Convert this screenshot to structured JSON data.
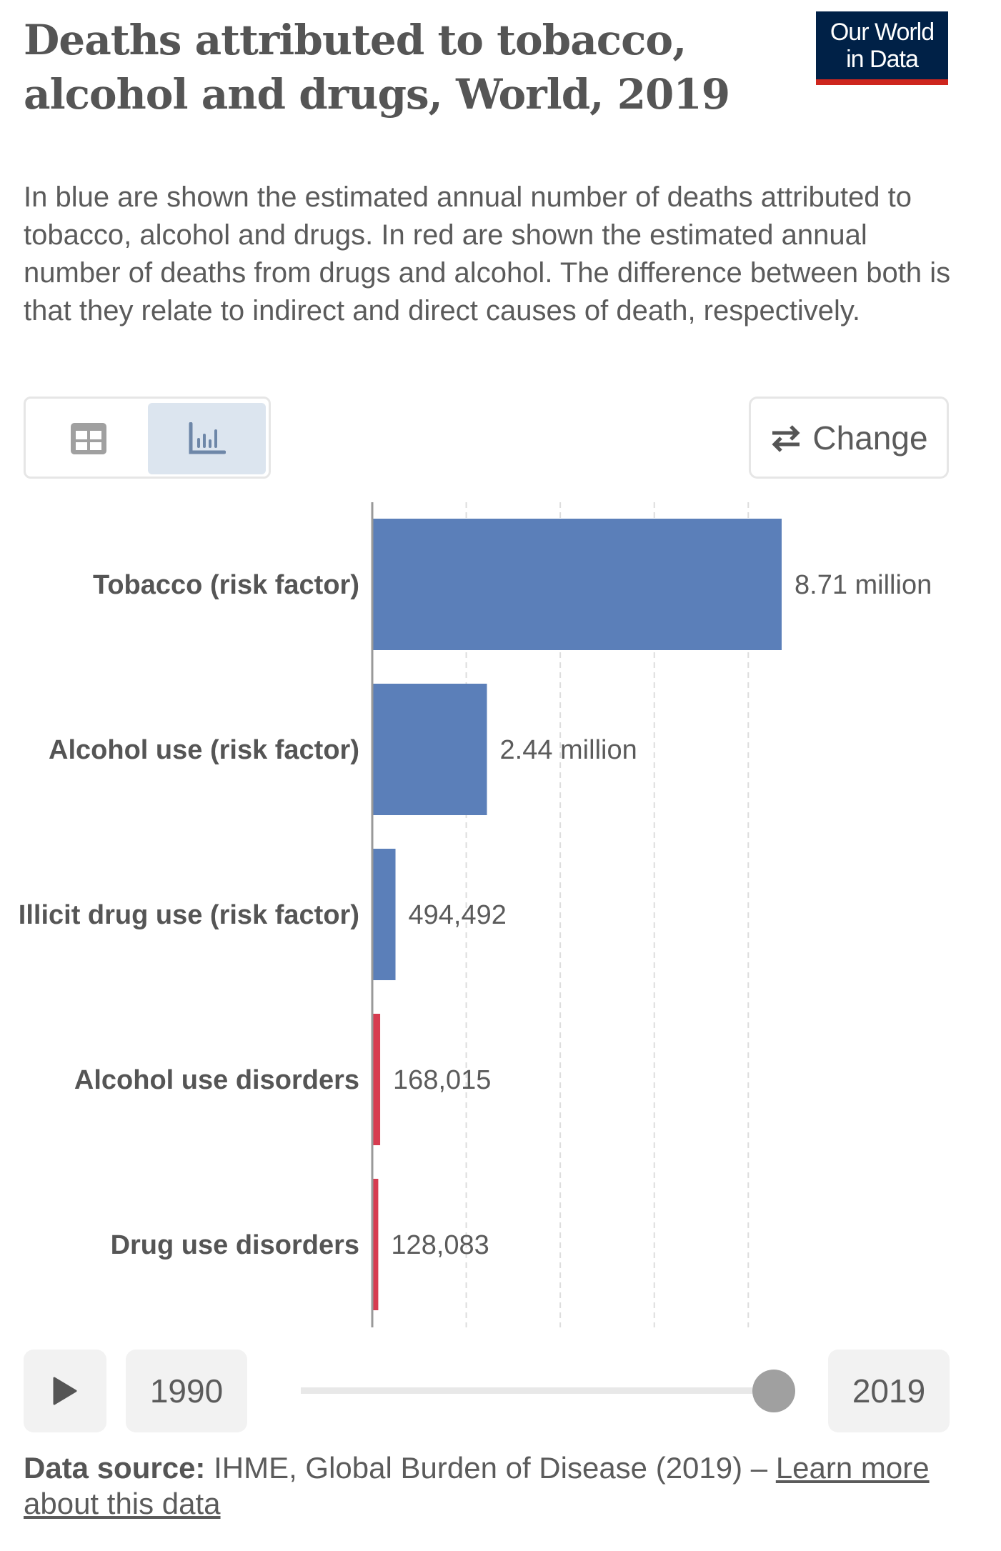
{
  "header": {
    "title": "Deaths attributed to tobacco, alcohol and drugs, World, 2019",
    "subtitle": "In blue are shown the estimated annual number of deaths attributed to tobacco, alcohol and drugs. In red are shown the estimated annual number of deaths from drugs and alcohol. The difference between both is that they relate to indirect and direct causes of death, respectively.",
    "logo_line1": "Our World",
    "logo_line2": "in Data"
  },
  "controls": {
    "table_icon": "table-icon",
    "chart_icon": "bar-chart-icon",
    "change_label": "Change",
    "change_icon": "swap-arrows-icon"
  },
  "chart_data": {
    "type": "bar",
    "orientation": "horizontal",
    "categories": [
      "Tobacco (risk factor)",
      "Alcohol use (risk factor)",
      "Illicit drug use (risk factor)",
      "Alcohol use disorders",
      "Drug use disorders"
    ],
    "values": [
      8710000,
      2440000,
      494492,
      168015,
      128083
    ],
    "value_labels": [
      "8.71 million",
      "2.44 million",
      "494,492",
      "168,015",
      "128,083"
    ],
    "colors": [
      "#5b7fb9",
      "#5b7fb9",
      "#5b7fb9",
      "#d73c50",
      "#d73c50"
    ],
    "xlim": [
      0,
      9000000
    ],
    "gridlines": [
      2000000,
      4000000,
      6000000,
      8000000
    ],
    "grid": true
  },
  "timeline": {
    "play_icon": "play-icon",
    "start_year": "1990",
    "end_year": "2019",
    "position": 1.0
  },
  "footer": {
    "source_label": "Data source:",
    "source_text": "IHME, Global Burden of Disease (2019) – ",
    "learn_more": "Learn more about this data"
  }
}
